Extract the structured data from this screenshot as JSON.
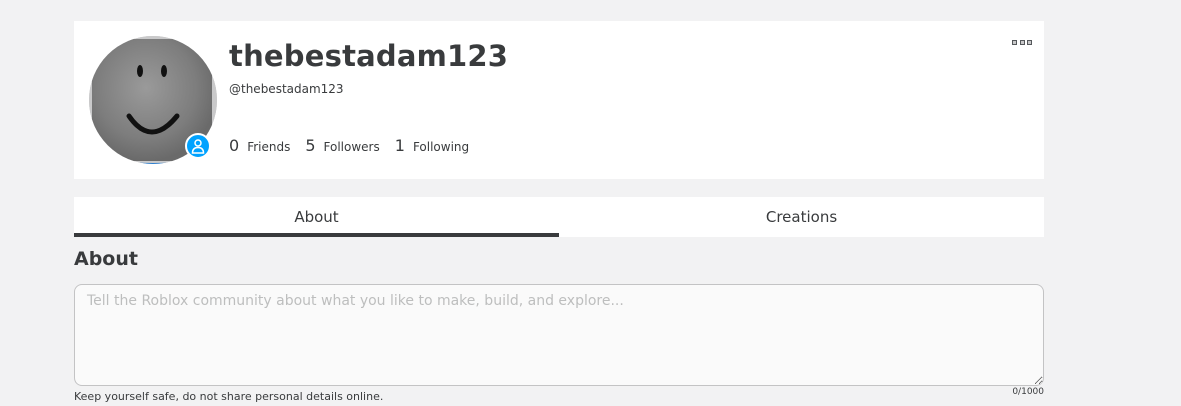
{
  "profile": {
    "display_name": "thebestadam123",
    "username": "@thebestadam123",
    "avatar_icon": "smiley-avatar-icon",
    "presence_icon": "person-icon",
    "presence_color": "#00a2ff",
    "stats": [
      {
        "count": "0",
        "label": "Friends"
      },
      {
        "count": "5",
        "label": "Followers"
      },
      {
        "count": "1",
        "label": "Following"
      }
    ],
    "more_icon": "more-options-icon"
  },
  "tabs": [
    {
      "label": "About",
      "active": true
    },
    {
      "label": "Creations",
      "active": false
    }
  ],
  "about": {
    "heading": "About",
    "placeholder": "Tell the Roblox community about what you like to make, build, and explore...",
    "value": "",
    "safety_note": "Keep yourself safe, do not share personal details online.",
    "char_count": "0/1000"
  }
}
